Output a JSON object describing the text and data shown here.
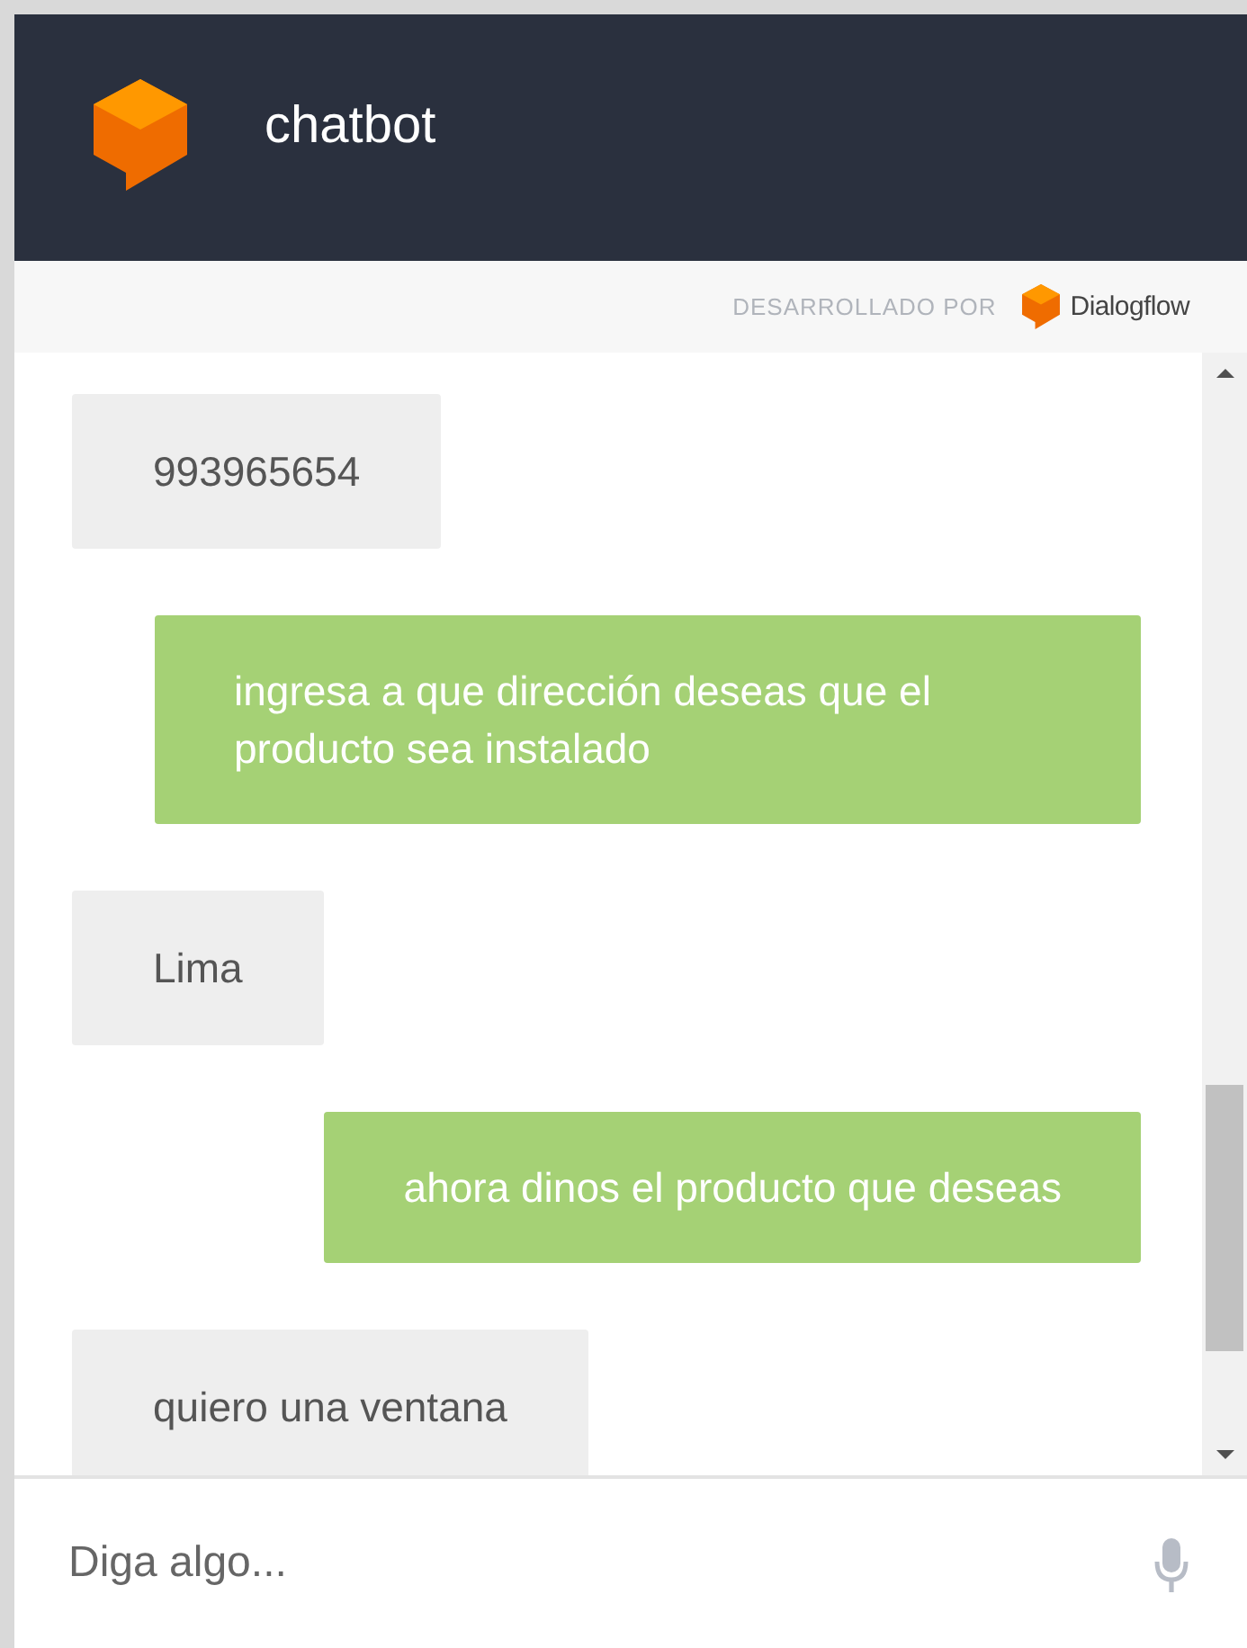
{
  "header": {
    "title": "chatbot"
  },
  "powered_by": {
    "label": "DESARROLLADO POR",
    "brand": "Dialogflow"
  },
  "messages": [
    {
      "kind": "user",
      "text": "993965654"
    },
    {
      "kind": "bot",
      "text": "ingresa a que dirección deseas que el producto sea instalado"
    },
    {
      "kind": "user",
      "text": "Lima"
    },
    {
      "kind": "bot",
      "text": "ahora dinos el producto que deseas"
    },
    {
      "kind": "user",
      "text": "quiero una ventana"
    }
  ],
  "input": {
    "placeholder": "Diga algo..."
  }
}
